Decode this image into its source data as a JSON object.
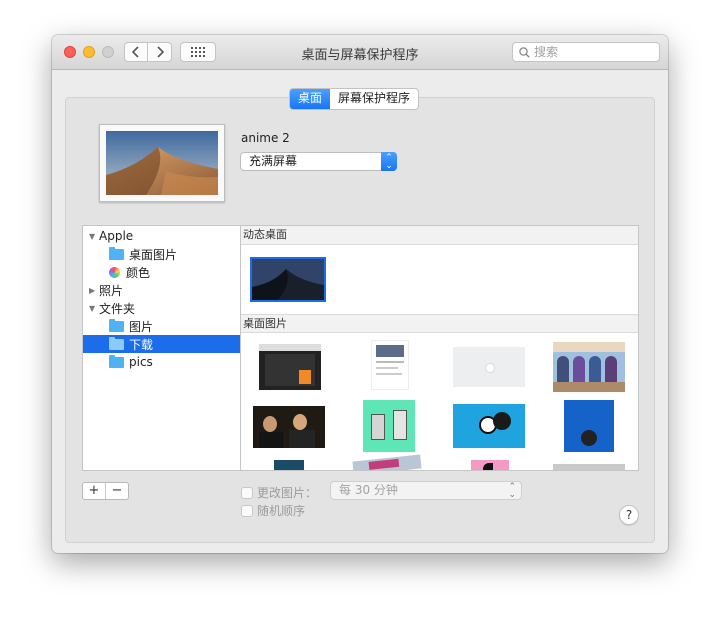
{
  "window": {
    "title": "桌面与屏幕保护程序"
  },
  "search": {
    "placeholder": "搜索"
  },
  "tabs": [
    {
      "label": "桌面",
      "active": true
    },
    {
      "label": "屏幕保护程序",
      "active": false
    }
  ],
  "current": {
    "name": "anime 2",
    "fill_mode": "充满屏幕"
  },
  "sidebar": {
    "items": [
      {
        "label": "Apple",
        "kind": "group",
        "expanded": true
      },
      {
        "label": "桌面图片",
        "kind": "folder-icon"
      },
      {
        "label": "颜色",
        "kind": "color-wheel-icon"
      },
      {
        "label": "照片",
        "kind": "group",
        "expanded": false
      },
      {
        "label": "文件夹",
        "kind": "group",
        "expanded": true
      },
      {
        "label": "图片",
        "kind": "folder-icon"
      },
      {
        "label": "下载",
        "kind": "folder-icon",
        "selected": true
      },
      {
        "label": "pics",
        "kind": "folder-icon"
      }
    ]
  },
  "sections": {
    "dynamic": "动态桌面",
    "desktop_pictures": "桌面图片"
  },
  "bottom": {
    "add": "+",
    "remove": "−",
    "change_picture": "更改图片：",
    "interval": "每 30 分钟",
    "random_order": "随机顺序",
    "help": "?"
  },
  "colors": {
    "accent": "#1b6dea",
    "selection": "#1b6dea"
  }
}
